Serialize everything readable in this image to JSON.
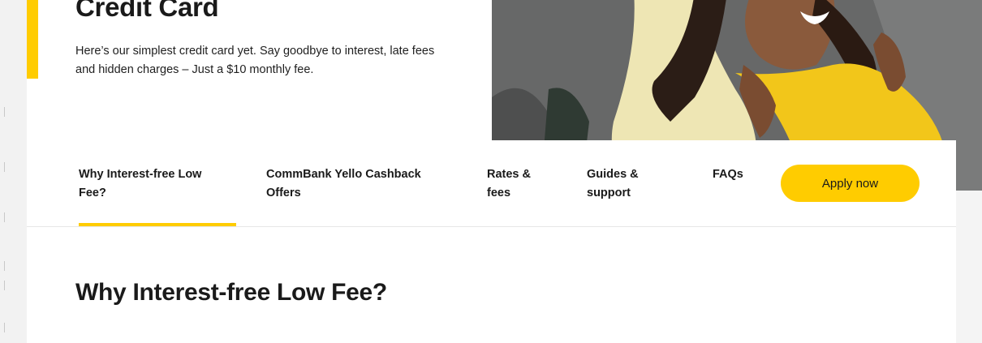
{
  "theme": {
    "accent": "#ffcc00",
    "text": "#1a1a1a"
  },
  "hero": {
    "title": "Credit Card",
    "description": "Here’s our simplest credit card yet. Say goodbye to interest, late fees and hidden charges – Just a $10 monthly fee."
  },
  "nav": {
    "items": [
      {
        "label": "Why Interest-free Low Fee?",
        "active": true
      },
      {
        "label": "CommBank Yello Cashback Offers",
        "active": false
      },
      {
        "label": "Rates & fees",
        "active": false
      },
      {
        "label": "Guides & support",
        "active": false
      },
      {
        "label": "FAQs",
        "active": false
      }
    ],
    "apply_label": "Apply now"
  },
  "section": {
    "title": "Why Interest-free Low Fee?"
  }
}
